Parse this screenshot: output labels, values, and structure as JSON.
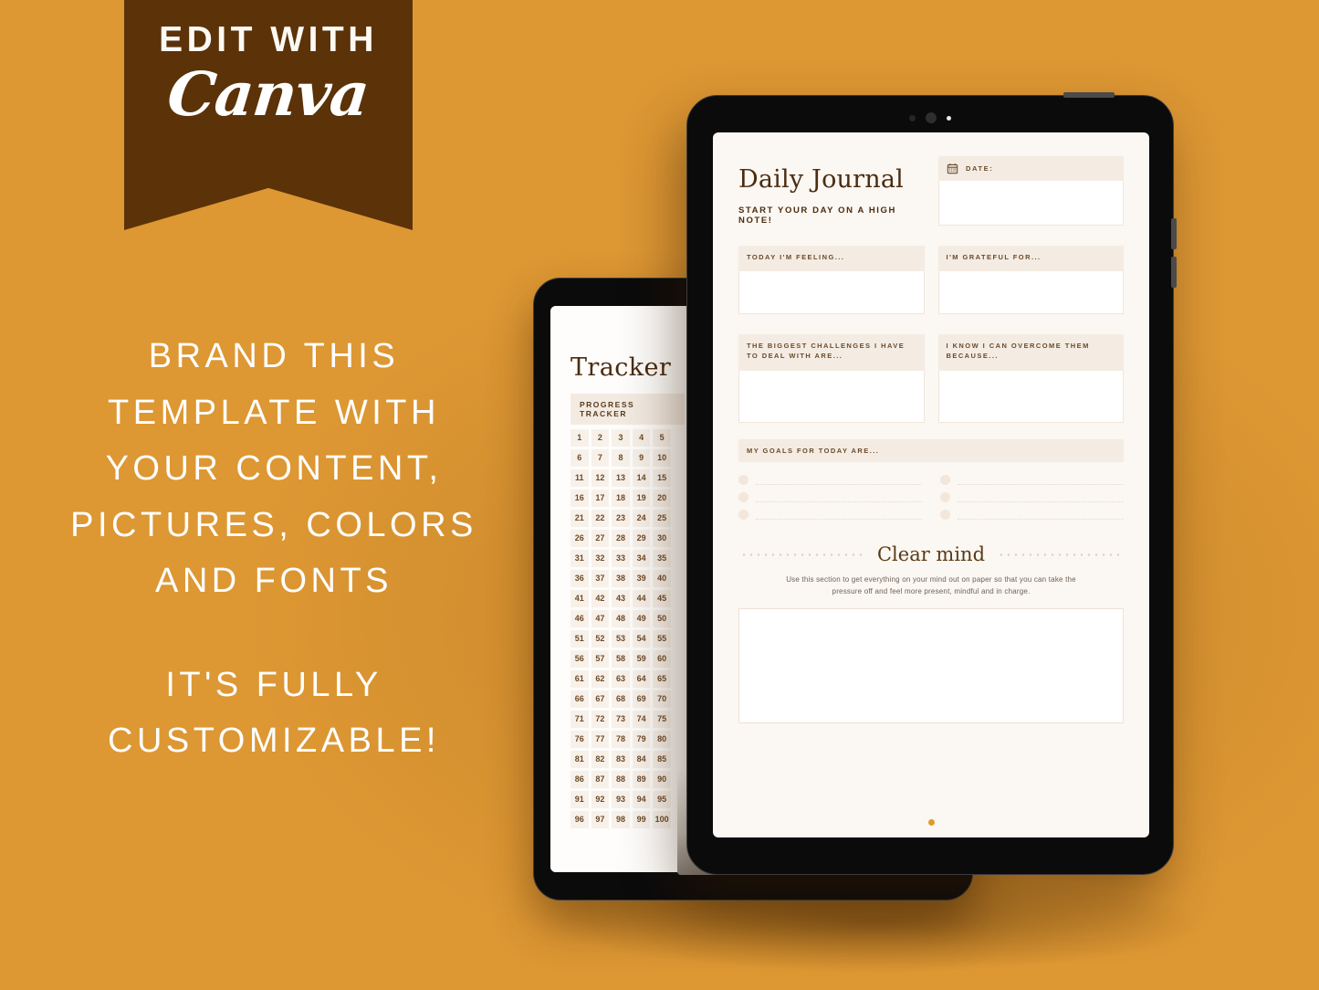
{
  "background_color": "#DD9733",
  "ribbon": {
    "bg_color": "#5C3208",
    "top_text": "EDIT WITH",
    "brand_text": "Canva"
  },
  "left_copy": {
    "block1": "BRAND THIS TEMPLATE WITH YOUR CONTENT, PICTURES, COLORS AND FONTS",
    "block2": "IT'S FULLY CUSTOMIZABLE!"
  },
  "rear_tablet": {
    "device_name": "tablet-rear",
    "page": {
      "title": "Tracker",
      "section_header": "PROGRESS TRACKER",
      "numbers": [
        1,
        2,
        3,
        4,
        5,
        6,
        7,
        8,
        9,
        10,
        11,
        12,
        13,
        14,
        15,
        16,
        17,
        18,
        19,
        20,
        21,
        22,
        23,
        24,
        25,
        26,
        27,
        28,
        29,
        30,
        31,
        32,
        33,
        34,
        35,
        36,
        37,
        38,
        39,
        40,
        41,
        42,
        43,
        44,
        45,
        46,
        47,
        48,
        49,
        50,
        51,
        52,
        53,
        54,
        55,
        56,
        57,
        58,
        59,
        60,
        61,
        62,
        63,
        64,
        65,
        66,
        67,
        68,
        69,
        70,
        71,
        72,
        73,
        74,
        75,
        76,
        77,
        78,
        79,
        80,
        81,
        82,
        83,
        84,
        85,
        86,
        87,
        88,
        89,
        90,
        91,
        92,
        93,
        94,
        95,
        96,
        97,
        98,
        99,
        100
      ],
      "columns": 5
    }
  },
  "ghost_layer": {
    "visible_rows": [
      [
        91,
        92,
        93,
        94,
        95
      ],
      [
        96,
        97,
        98,
        99,
        100
      ]
    ]
  },
  "front_tablet": {
    "device_name": "tablet-front",
    "page": {
      "title": "Daily Journal",
      "subtitle": "START YOUR DAY ON A HIGH NOTE!",
      "date_field": {
        "icon": "calendar-icon",
        "label": "DATE:",
        "value": ""
      },
      "fields": [
        {
          "label": "TODAY I'M FEELING...",
          "value": ""
        },
        {
          "label": "I'M GRATEFUL FOR...",
          "value": ""
        },
        {
          "label": "THE BIGGEST CHALLENGES I HAVE TO DEAL WITH ARE...",
          "value": ""
        },
        {
          "label": "I KNOW I CAN OVERCOME THEM BECAUSE...",
          "value": ""
        }
      ],
      "goals": {
        "header": "MY GOALS FOR TODAY ARE...",
        "left_items": [
          "",
          "",
          ""
        ],
        "right_items": [
          "",
          "",
          ""
        ]
      },
      "clear_mind": {
        "title": "Clear mind",
        "description": "Use this section to get everything on your mind out on paper so that you can take the pressure off and feel more present, mindful and in charge.",
        "note_value": ""
      }
    }
  },
  "accent_colors": {
    "orange": "#DD9733",
    "dark_brown": "#5C3208",
    "paper": "#FBF7F2",
    "field_header": "#F4ECE3",
    "page_dot": "#E09A28"
  }
}
